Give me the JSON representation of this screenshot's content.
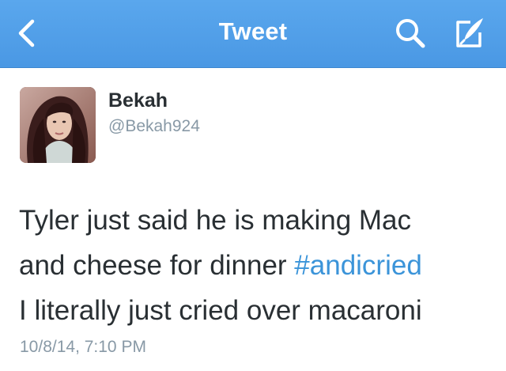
{
  "navbar": {
    "title": "Tweet",
    "back_icon": "chevron-left-icon",
    "search_icon": "search-icon",
    "compose_icon": "compose-icon",
    "background": "#55a3ec"
  },
  "tweet": {
    "author_name": "Bekah",
    "author_handle": "@Bekah924",
    "text_line1": "Tyler just said he is making Mac",
    "text_line2_before": "and cheese for dinner ",
    "hashtag": "#andicried",
    "text_line3": "I literally just cried over macaroni",
    "timestamp": "10/8/14, 7:10 PM",
    "hashtag_color": "#3b94d9"
  }
}
